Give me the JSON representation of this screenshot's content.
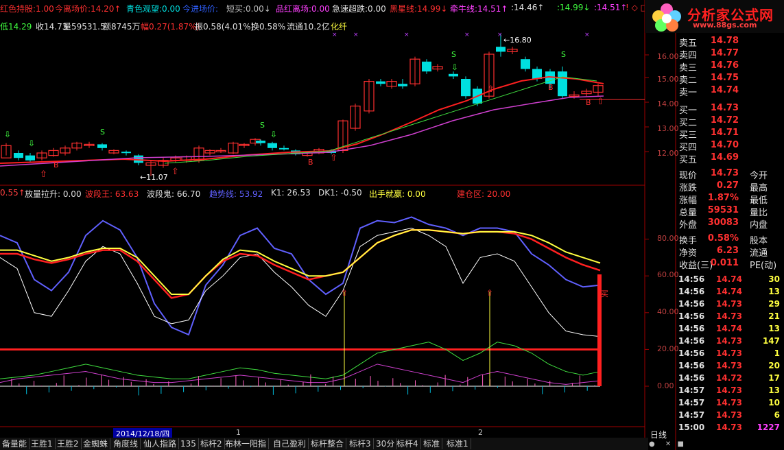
{
  "topbar": {
    "items": [
      {
        "label": "红色持股:",
        "value": "1.00",
        "color": "#ff3030"
      },
      {
        "label": "今离场价:",
        "value": "14.20",
        "arrow": "↑",
        "color": "#ff3030"
      },
      {
        "label": "青色观望:",
        "value": "0.00",
        "color": "#00e0e0"
      },
      {
        "label": "今进场价:",
        "value": "",
        "color": "#3060ff"
      },
      {
        "label": "短买:",
        "value": "0.00",
        "arrow": "↓",
        "color": "#c0c0c0"
      },
      {
        "label": "品红离场:",
        "value": "0.00",
        "color": "#ff40ff"
      },
      {
        "label": "急速超跌:",
        "value": "0.00",
        "color": "#e0e0e0"
      },
      {
        "label": "黑星线:",
        "value": "14.99",
        "arrow": "↓",
        "color": "#ff3030"
      },
      {
        "label": "牵牛线:",
        "value": "14.51",
        "arrow": "↑",
        "color": "#ff40ff"
      },
      {
        "label": ":",
        "value": "14.46",
        "arrow": "↑",
        "color": "#e0e0e0"
      },
      {
        "label": ":",
        "value": "14.99",
        "arrow": "↓",
        "color": "#40ff40"
      },
      {
        "label": ":",
        "value": "14.51",
        "arrow": "↑",
        "color": "#ff40ff"
      }
    ],
    "tail_icons": "! ◇ □"
  },
  "pricebar": {
    "low": "低14.29",
    "close": "收14.73",
    "volume": "量59531.5",
    "amount": "额8745万",
    "range": "幅0.27(1.87%)",
    "amplitude": "振0.58(4.01%)",
    "turnover": "换0.58%",
    "float": "流通10.2亿",
    "sector": "化纤"
  },
  "indbar": {
    "items": [
      {
        "text": "0.55↑",
        "color": "#ff4040"
      },
      {
        "text": "放量拉升: 0.00",
        "color": "#e0e0e0"
      },
      {
        "text": "波段王: 63.63",
        "color": "#ff3030"
      },
      {
        "text": "波段鬼: 66.70",
        "color": "#e0e0e0"
      },
      {
        "text": "趋势线: 53.92",
        "color": "#6060ff"
      },
      {
        "text": "K1: 26.53",
        "color": "#e0e0e0"
      },
      {
        "text": "DK1: -0.50",
        "color": "#e0e0e0"
      },
      {
        "text": "出手就赢: 0.00",
        "color": "#ffff40"
      },
      {
        "text": "建仓区: 20.00",
        "color": "#ff3030"
      }
    ]
  },
  "axis": {
    "price_ticks": [
      "16.00",
      "15.00",
      "14.00",
      "13.00",
      "12.00"
    ],
    "ind_ticks": [
      "80.00",
      "60.00",
      "40.00",
      "20.00",
      "0.00"
    ]
  },
  "annotations": {
    "high": "16.80",
    "low": "11.07",
    "buy_marks": [
      "B",
      "B",
      "B",
      "B"
    ],
    "sell_marks": [
      "S",
      "S",
      "S",
      "S",
      "S"
    ],
    "buy_signal": "买"
  },
  "logo": {
    "text": "分析家公式网",
    "url": "www.88gs.com"
  },
  "orderbook": {
    "sell": [
      {
        "label": "卖五",
        "price": "14.78"
      },
      {
        "label": "卖四",
        "price": "14.77"
      },
      {
        "label": "卖三",
        "price": "14.76"
      },
      {
        "label": "卖二",
        "price": "14.75"
      },
      {
        "label": "卖一",
        "price": "14.74"
      }
    ],
    "buy": [
      {
        "label": "买一",
        "price": "14.73"
      },
      {
        "label": "买二",
        "price": "14.72"
      },
      {
        "label": "买三",
        "price": "14.71"
      },
      {
        "label": "买四",
        "price": "14.70"
      },
      {
        "label": "买五",
        "price": "14.69"
      }
    ]
  },
  "quote": [
    {
      "label": "现价",
      "value": "14.73",
      "label2": "今开"
    },
    {
      "label": "涨跌",
      "value": "0.27",
      "label2": "最高"
    },
    {
      "label": "涨幅",
      "value": "1.87%",
      "label2": "最低"
    },
    {
      "label": "总量",
      "value": "59531",
      "label2": "量比"
    },
    {
      "label": "外盘",
      "value": "30083",
      "label2": "内盘"
    },
    {
      "label": "换手",
      "value": "0.58%",
      "label2": "股本"
    },
    {
      "label": "净资",
      "value": "6.23",
      "label2": "流通"
    },
    {
      "label": "收益(三)",
      "value": "0.011",
      "label2": "PE(动)"
    }
  ],
  "trades": [
    {
      "time": "14:56",
      "price": "14.74",
      "vol": "30",
      "color": "#ff3030"
    },
    {
      "time": "14:56",
      "price": "14.74",
      "vol": "13",
      "color": "#ff3030"
    },
    {
      "time": "14:56",
      "price": "14.73",
      "vol": "29",
      "color": "#ff3030"
    },
    {
      "time": "14:56",
      "price": "14.73",
      "vol": "21",
      "color": "#ff3030"
    },
    {
      "time": "14:56",
      "price": "14.74",
      "vol": "13",
      "color": "#ff3030"
    },
    {
      "time": "14:56",
      "price": "14.73",
      "vol": "147",
      "color": "#ff3030"
    },
    {
      "time": "14:56",
      "price": "14.73",
      "vol": "1",
      "color": "#ff3030"
    },
    {
      "time": "14:56",
      "price": "14.73",
      "vol": "20",
      "color": "#ff3030"
    },
    {
      "time": "14:56",
      "price": "14.72",
      "vol": "17",
      "color": "#ff3030"
    },
    {
      "time": "14:57",
      "price": "14.73",
      "vol": "13",
      "color": "#ff3030"
    },
    {
      "time": "14:57",
      "price": "14.73",
      "vol": "10",
      "color": "#ff3030"
    },
    {
      "time": "14:57",
      "price": "14.73",
      "vol": "6",
      "color": "#ff3030"
    },
    {
      "time": "15:00",
      "price": "14.73",
      "vol": "1227",
      "color": "#ff3030"
    }
  ],
  "datebar": {
    "date": "2014/12/18/四",
    "marks": [
      "1",
      "2"
    ]
  },
  "period": "日线",
  "tabs": [
    "备量能",
    "王胜1",
    "王胜2",
    "金蜘蛛",
    "角度线",
    "仙人指路",
    "135",
    "标杆2",
    "布林一阳指",
    "自己盈利",
    "标杆整合",
    "标杆3",
    "30分",
    "标杆4",
    "标准",
    "标准1"
  ],
  "colors": {
    "up": "#ff3030",
    "down": "#00e0e0",
    "ma_red": "#ff2020",
    "ma_purple": "#d040d0",
    "ma_green": "#40e040",
    "yellow": "#ffff40",
    "blue": "#6060ff",
    "white": "#ffffff"
  }
}
